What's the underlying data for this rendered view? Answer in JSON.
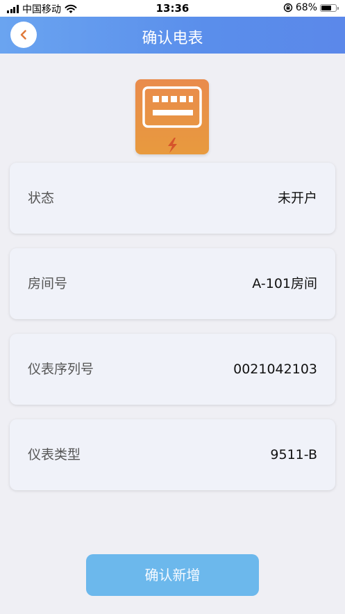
{
  "status_bar": {
    "carrier": "中国移动",
    "time": "13:36",
    "battery_percent": "68%",
    "battery_level": 0.68
  },
  "nav": {
    "title": "确认电表"
  },
  "meter_info": [
    {
      "label": "状态",
      "value": "未开户"
    },
    {
      "label": "房间号",
      "value": "A-101房间"
    },
    {
      "label": "仪表序列号",
      "value": "0021042103"
    },
    {
      "label": "仪表类型",
      "value": "9511-B"
    }
  ],
  "confirm_button": {
    "label": "确认新增"
  },
  "colors": {
    "nav_gradient_start": "#6aa4f0",
    "nav_gradient_end": "#5b88ea",
    "meter_icon": "#e8923f",
    "confirm_button": "#6cb8ec",
    "back_arrow": "#e07a3a"
  }
}
